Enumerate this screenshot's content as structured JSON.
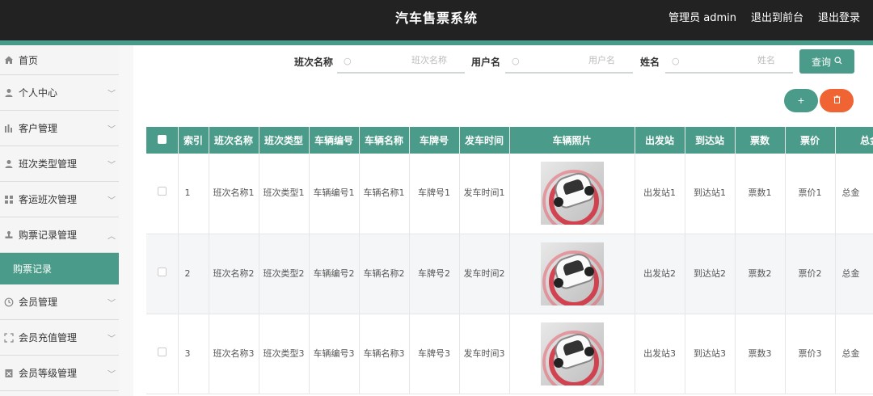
{
  "header": {
    "title": "汽车售票系统",
    "admin_label": "管理员 admin",
    "to_front_label": "退出到前台",
    "logout_label": "退出登录"
  },
  "sidebar": {
    "items": [
      {
        "label": "首页",
        "icon": "home-icon"
      },
      {
        "label": "个人中心",
        "icon": "user-icon"
      },
      {
        "label": "客户管理",
        "icon": "chart-icon"
      },
      {
        "label": "班次类型管理",
        "icon": "user-icon"
      },
      {
        "label": "客运班次管理",
        "icon": "grid-icon"
      },
      {
        "label": "购票记录管理",
        "icon": "stamp-icon"
      },
      {
        "label": "会员管理",
        "icon": "clock-icon"
      },
      {
        "label": "会员充值管理",
        "icon": "frame-icon"
      },
      {
        "label": "会员等级管理",
        "icon": "doc-icon"
      }
    ],
    "active_sub": "购票记录"
  },
  "search": {
    "f1_label": "班次名称",
    "f1_placeholder": "班次名称",
    "f2_label": "用户名",
    "f2_placeholder": "用户名",
    "f3_label": "姓名",
    "f3_placeholder": "姓名",
    "query_label": "查询"
  },
  "actions": {
    "add_label": "+",
    "delete_label": "🗑"
  },
  "table": {
    "headers": [
      "索引",
      "班次名称",
      "班次类型",
      "车辆编号",
      "车辆名称",
      "车牌号",
      "发车时间",
      "车辆照片",
      "出发站",
      "到达站",
      "票数",
      "票价",
      "总金"
    ],
    "rows": [
      {
        "idx": "1",
        "c1": "班次名称1",
        "c2": "班次类型1",
        "c3": "车辆编号1",
        "c4": "车辆名称1",
        "c5": "车牌号1",
        "c6": "发车时间1",
        "c8": "出发站1",
        "c9": "到达站1",
        "c10": "票数1",
        "c11": "票价1",
        "c12": "总金"
      },
      {
        "idx": "2",
        "c1": "班次名称2",
        "c2": "班次类型2",
        "c3": "车辆编号2",
        "c4": "车辆名称2",
        "c5": "车牌号2",
        "c6": "发车时间2",
        "c8": "出发站2",
        "c9": "到达站2",
        "c10": "票数2",
        "c11": "票价2",
        "c12": "总金"
      },
      {
        "idx": "3",
        "c1": "班次名称3",
        "c2": "班次类型3",
        "c3": "车辆编号3",
        "c4": "车辆名称3",
        "c5": "车牌号3",
        "c6": "发车时间3",
        "c8": "出发站3",
        "c9": "到达站3",
        "c10": "票数3",
        "c11": "票价3",
        "c12": "总金"
      }
    ]
  },
  "colors": {
    "header_bg": "#222222",
    "accent": "#4a9b89",
    "danger": "#f06434"
  }
}
